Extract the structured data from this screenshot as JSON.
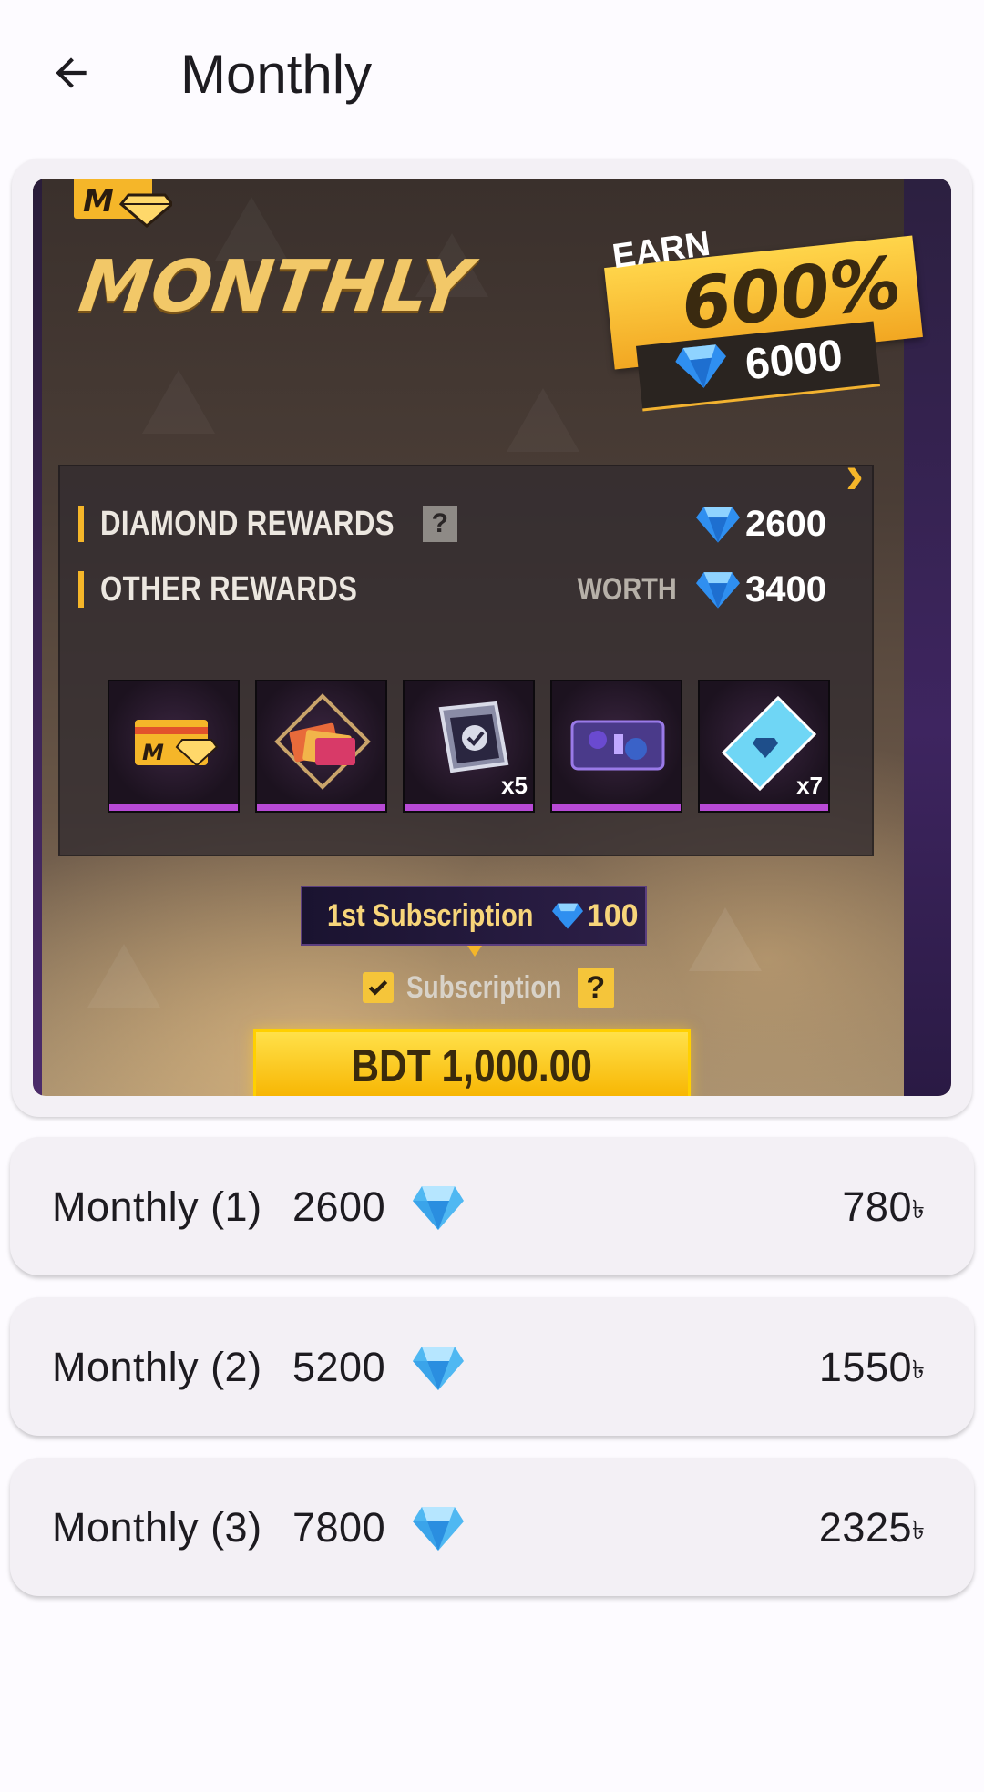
{
  "appbar": {
    "title": "Monthly",
    "back_icon": "arrow-back-icon"
  },
  "banner": {
    "title": "MONTHLY",
    "badge_letter": "M",
    "earn_label": "EARN",
    "earn_percent": "600%",
    "earn_diamonds": "6000",
    "diamond_rewards_label": "DIAMOND REWARDS",
    "diamond_rewards_help": "?",
    "diamond_rewards_value": "2600",
    "other_rewards_label": "OTHER REWARDS",
    "worth_label": "WORTH",
    "other_rewards_value": "3400",
    "reward_items": [
      {
        "name": "monthly-card-item",
        "qty": ""
      },
      {
        "name": "cards-bundle-item",
        "qty": ""
      },
      {
        "name": "calendar-voucher-item",
        "qty": "x5"
      },
      {
        "name": "crate-item",
        "qty": ""
      },
      {
        "name": "diamond-ticket-item",
        "qty": "x7"
      }
    ],
    "first_sub_label": "1st Subscription",
    "first_sub_value": "100",
    "subscription_label": "Subscription",
    "subscription_help": "?",
    "price": "BDT 1,000.00",
    "colors": {
      "gold": "#f5b629",
      "purple_bar": "#b84ad6",
      "price_button": "#ffd000"
    }
  },
  "products": [
    {
      "label": "Monthly (1)",
      "diamonds": "2600",
      "price": "780",
      "currency": "৳",
      "icon": "diamond-icon"
    },
    {
      "label": "Monthly (2)",
      "diamonds": "5200",
      "price": "1550",
      "currency": "৳",
      "icon": "diamond-icon"
    },
    {
      "label": "Monthly (3)",
      "diamonds": "7800",
      "price": "2325",
      "currency": "৳",
      "icon": "diamond-icon"
    }
  ]
}
